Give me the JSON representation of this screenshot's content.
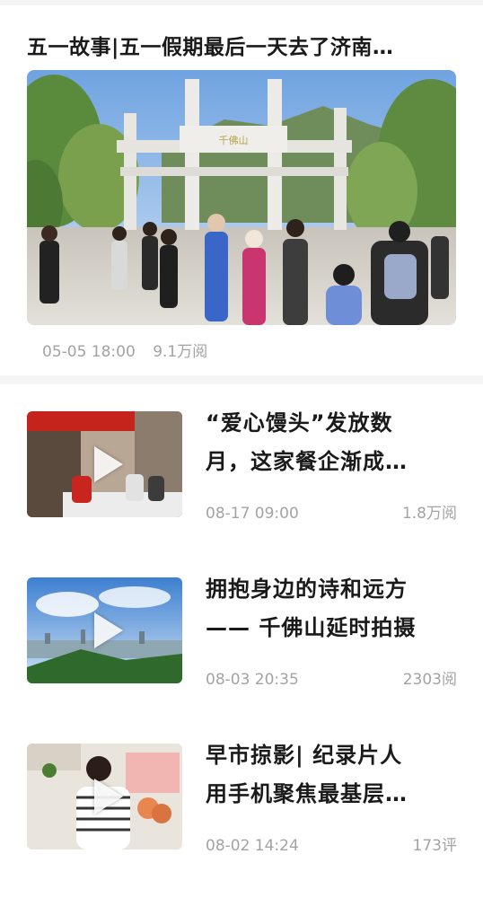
{
  "featured": {
    "title": "五一故事|五一假期最后一天去了济南…",
    "image_alt": "千佛山 gate crowd",
    "gate_sign": "千佛山",
    "date": "05-05 18:00",
    "views": "9.1万阅"
  },
  "items": [
    {
      "title_line1": "“爱心馒头”发放数",
      "title_line2": "月，这家餐企渐成…",
      "date": "08-17 09:00",
      "count": "1.8万阅",
      "thumb_icon": "play-icon"
    },
    {
      "title_line1": "拥抱身边的诗和远方",
      "title_line2": "—— 千佛山延时拍摄",
      "date": "08-03 20:35",
      "count": "2303阅",
      "thumb_icon": "play-icon"
    },
    {
      "title_line1": "早市掠影| 纪录片人",
      "title_line2": "用手机聚焦最基层…",
      "date": "08-02 14:24",
      "count": "173评",
      "thumb_icon": "play-icon"
    }
  ],
  "colors": {
    "title": "#1a1a1a",
    "meta": "#a3a3a3",
    "divider": "#f5f5f5"
  }
}
